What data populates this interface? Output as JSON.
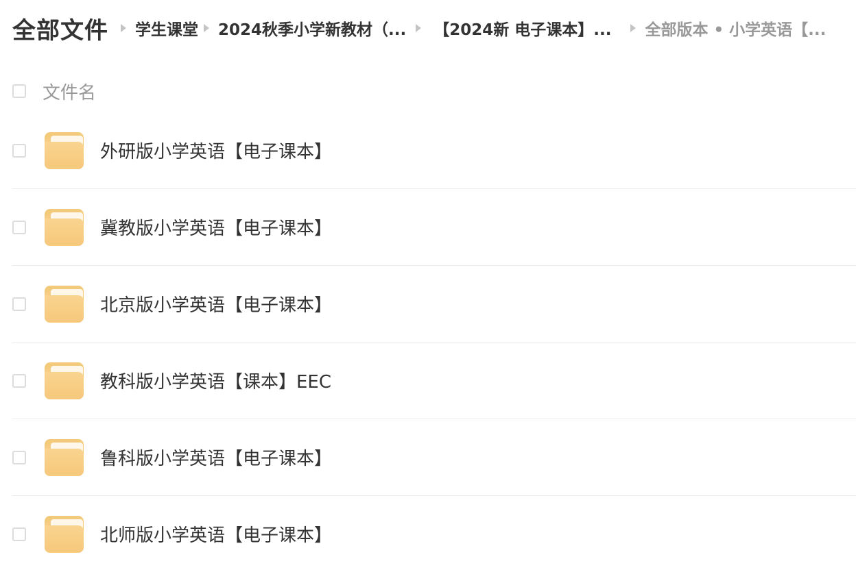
{
  "header": {
    "title": "全部文件",
    "breadcrumbs": [
      "学生课堂",
      "2024秋季小学新教材（...",
      "【2024新 电子课本】...",
      "全部版本 • 小学英语【..."
    ]
  },
  "list_header": {
    "column_label": "文件名"
  },
  "files": [
    {
      "name": "外研版小学英语【电子课本】"
    },
    {
      "name": "冀教版小学英语【电子课本】"
    },
    {
      "name": "北京版小学英语【电子课本】"
    },
    {
      "name": "教科版小学英语【课本】EEC"
    },
    {
      "name": "鲁科版小学英语【电子课本】"
    },
    {
      "name": "北师版小学英语【电子课本】"
    }
  ],
  "icons": {
    "folder": "folder-icon",
    "separator": "breadcrumb-separator-icon",
    "checkbox": "checkbox"
  },
  "colors": {
    "folder": "#f6c97c",
    "text": "#333333",
    "muted": "#999999",
    "divider": "#ececec"
  }
}
